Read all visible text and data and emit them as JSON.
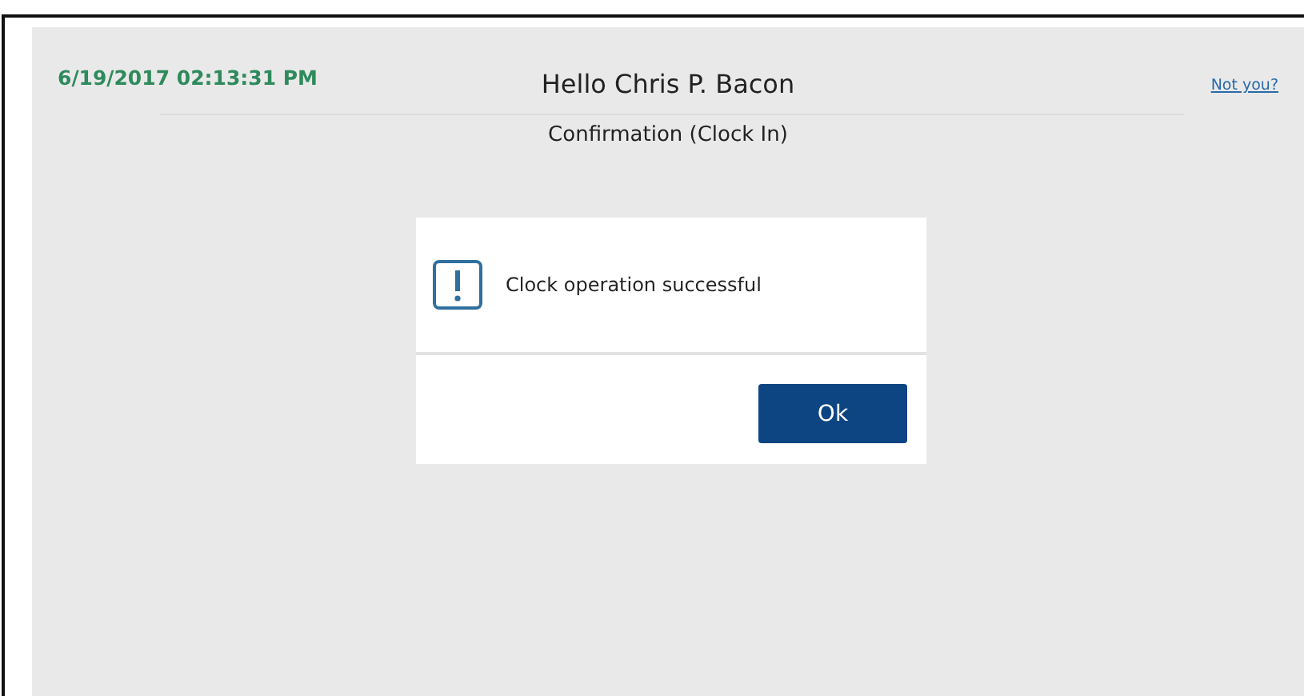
{
  "header": {
    "datetime": "6/19/2017 02:13:31 PM",
    "greeting": "Hello Chris P. Bacon",
    "link": "Not you?"
  },
  "subtitle": "Confirmation (Clock In)",
  "dialog": {
    "message": "Clock operation successful",
    "buttons": [
      "Ok"
    ]
  }
}
